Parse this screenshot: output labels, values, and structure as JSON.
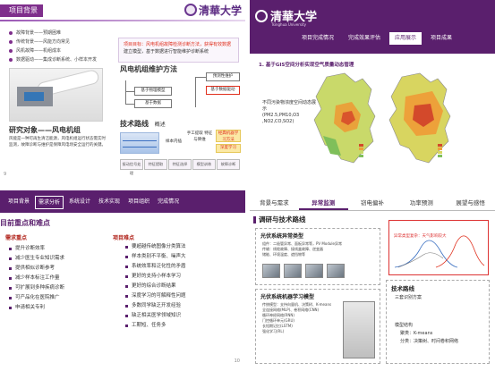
{
  "colors": {
    "brand_purple": "#5a1f6d",
    "accent_red": "#e0301e",
    "highlight_yellow": "#fbe9a5"
  },
  "slide1": {
    "tag": "项目背景",
    "logo_text": "清華大学",
    "bullets": [
      "故障背景——预期困难",
      "传统背景——风能方向常见",
      "风机故障——机组成本",
      "数据驱动——集成诊断系统、小样本开发"
    ],
    "bg_card_lines": [
      "项目目标：风电机组故障检测诊断方法，获得有效数据",
      "建立模型，基于数据进行智能维护诊断系统"
    ],
    "wind_head": "风电机组维护方法",
    "flow": [
      "基于物理模型",
      "基于数据",
      "基于数据驱动",
      "预测性维护"
    ],
    "maint_title": "研究对象——风电机组",
    "maint_text": "风能是一种可再生清洁能源，风电机组运行状态需实时监测，故障诊断与维护是保障风电场安全运行的关键。",
    "tech_head": "技术路线",
    "tech_note": "概述",
    "tech_cells": [
      "样本内插",
      "手工提取\n特征与降维",
      "经典机器学习方法",
      "深度学习"
    ],
    "tech_row": [
      "振动信号处理",
      "特征提取",
      "特征选择",
      "模型训练",
      "故障诊断"
    ],
    "page": "9"
  },
  "slide2": {
    "logo_text": "清華大学",
    "logo_sub": "Tsinghua University",
    "tabs": [
      "项目完成情况",
      "完成效果评估",
      "应用展示",
      "项目成果"
    ],
    "active_tab": 2,
    "section": "1. 基于GIS空间分析实现空气质量动态管理",
    "map_label": "不同污染物浓度空间动态展示\n(PM2.5,PM10,O3\n,NO2,CO,SO2)"
  },
  "slide3": {
    "nav": [
      "项目背景",
      "需求分析",
      "系统设计",
      "技术实现",
      "项目组织",
      "完成情况"
    ],
    "active_nav": 1,
    "section": "目前重点和难点",
    "col1_head": "需求重点",
    "col1": [
      "提升诊断效率",
      "减少医生专业知识需求",
      "提供相似诊断参考",
      "减少样本标注工作量",
      "可扩展到多种疾病诊断",
      "可产品化在医院推广",
      "申请相关专利"
    ],
    "col2_head": "项目难点",
    "col2": [
      "要超越传统图像分类算法",
      "样本类别不平衡、噪声大",
      "系统效率和泛化性的矛盾",
      "更好的支持小样本学习",
      "更好的综合诊断结果",
      "深度学习的可解释性问题",
      "多数同学缺乏开发经验",
      "缺乏相关医学领域知识",
      "工期短、任务多"
    ],
    "page": "10"
  },
  "slide4": {
    "tabs": [
      "背景与需求",
      "异常监测",
      "窃电偏补",
      "功率预测",
      "展望与感悟"
    ],
    "active_tab": 1,
    "section": "调研与技术路线",
    "card1_title": "光伏系统异常类型",
    "card1_lines": [
      "组件：二极管异常、面板异常等，PV Module异常",
      "传输：线缆故障、接线盒故障、逆变器",
      "储能、环境温度、遮挡物等"
    ],
    "card2_title": "光伏系统机器学习模型",
    "card2_lines": [
      "传统模型：支持向量机、决策树、K-means",
      "全连接网络(MLP)、卷积网络(CNN)",
      "循环神经网络(RNN)",
      "门控循环单元(GRU)",
      "长短期记忆(LSTM)",
      "强化学习(RL)"
    ],
    "red_label": "异常类型复杂：天气影响较大",
    "right_head": "技术路线",
    "right_lines": [
      "三套识别方案",
      "模型结构",
      "聚类：K-means",
      "分类：决策树、时间卷积网络"
    ]
  }
}
